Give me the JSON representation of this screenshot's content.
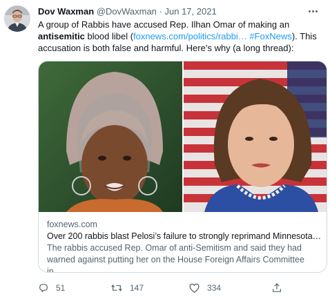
{
  "tweet": {
    "author_name": "Dov Waxman",
    "handle": "@DovWaxman",
    "separator": "·",
    "date": "Jun 17, 2021",
    "text_part1": "A group of Rabbis have accused Rep. Ilhan Omar of making an ",
    "text_bold": "antisemitic",
    "text_part2": " blood libel (",
    "text_link1": "foxnews.com/politics/rabbi…",
    "text_part3": " ",
    "text_link2": "#FoxNews",
    "text_part4": "). This accusation is both false and harmful. Here’s why (a long thread):"
  },
  "card": {
    "domain": "foxnews.com",
    "title": "Over 200 rabbis blast Pelosi’s failure to strongly reprimand Minnesota…",
    "description": "The rabbis accused Rep. Omar of anti-Semitism and said they had warned against putting her on the House Foreign Affairs Committee in…"
  },
  "actions": {
    "replies": "51",
    "retweets": "147",
    "likes": "334"
  },
  "icons": {
    "more": "more-horizontal-icon",
    "reply": "reply-icon",
    "retweet": "retweet-icon",
    "like": "heart-icon",
    "share": "share-icon"
  },
  "colors": {
    "link": "#1d9bf0",
    "secondary_text": "#536471",
    "border": "#cfd9de"
  }
}
